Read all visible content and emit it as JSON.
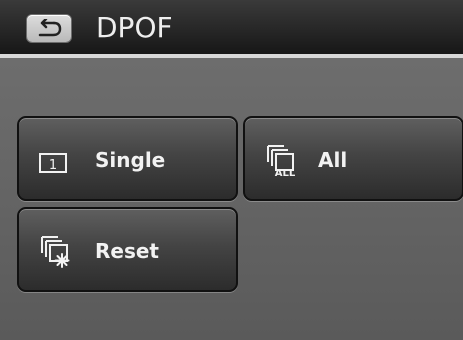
{
  "header": {
    "title": "DPOF",
    "back_icon": "back-icon"
  },
  "menu": {
    "items": [
      {
        "label": "Single",
        "icon": "single-print-icon"
      },
      {
        "label": "All",
        "icon": "all-print-icon",
        "icon_text": "ALL"
      },
      {
        "label": "Reset",
        "icon": "reset-print-icon"
      }
    ]
  },
  "colors": {
    "header_background": "#171717",
    "header_border": "#d7d7d7",
    "screen_background": "#6a6a6a",
    "button_background": "#444444",
    "text": "#f2f2f2"
  }
}
